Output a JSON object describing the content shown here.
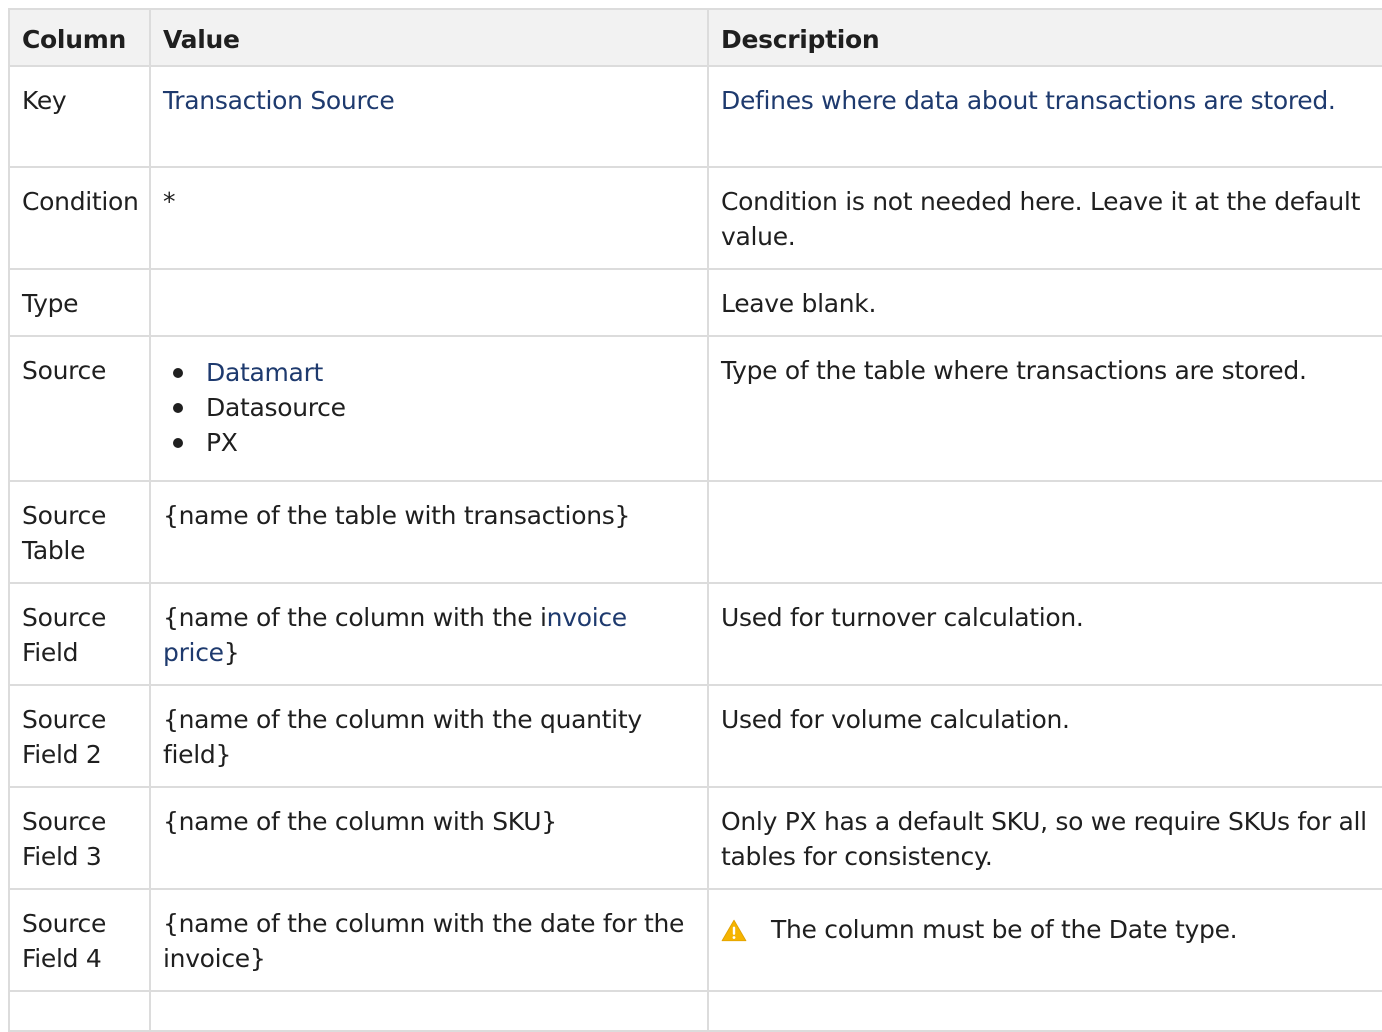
{
  "headers": [
    "Column",
    "Value",
    "Description"
  ],
  "rows": {
    "key": {
      "column": "Key",
      "value": "Transaction Source",
      "description": "Defines where data about transactions are stored."
    },
    "condition": {
      "column": "Condition",
      "value": "*",
      "description": "Condition is not needed here. Leave it at the default value."
    },
    "type": {
      "column": "Type",
      "value": "",
      "description": "Leave blank."
    },
    "source": {
      "column": "Source",
      "values": [
        "Datamart",
        "Datasource",
        "PX"
      ],
      "description": "Type of the table where transactions are stored."
    },
    "source_table": {
      "column": "Source Table",
      "value": "{name of the table with transactions}",
      "description": ""
    },
    "source_field": {
      "column": "Source Field",
      "value_prefix": "{name of the column with the i",
      "value_link": "nvoice price",
      "value_suffix": "}",
      "description": "Used for turnover calculation."
    },
    "source_field_2": {
      "column": "Source Field 2",
      "value": "{name of the column with the quantity field}",
      "description": "Used for volume calculation."
    },
    "source_field_3": {
      "column": "Source Field 3",
      "value": "{name of the column with SKU}",
      "description": "Only PX has a default SKU, so we require SKUs for all tables for consistency."
    },
    "source_field_4": {
      "column": "Source Field 4",
      "value": "{name of the column with the date for the invoice}",
      "description": "The column must be of the Date type.",
      "icon": "warning-icon"
    }
  },
  "colors": {
    "link": "#1e3a6e",
    "header_bg": "#f2f2f2",
    "border": "#dcdcdc",
    "warning": "#f5b400"
  }
}
